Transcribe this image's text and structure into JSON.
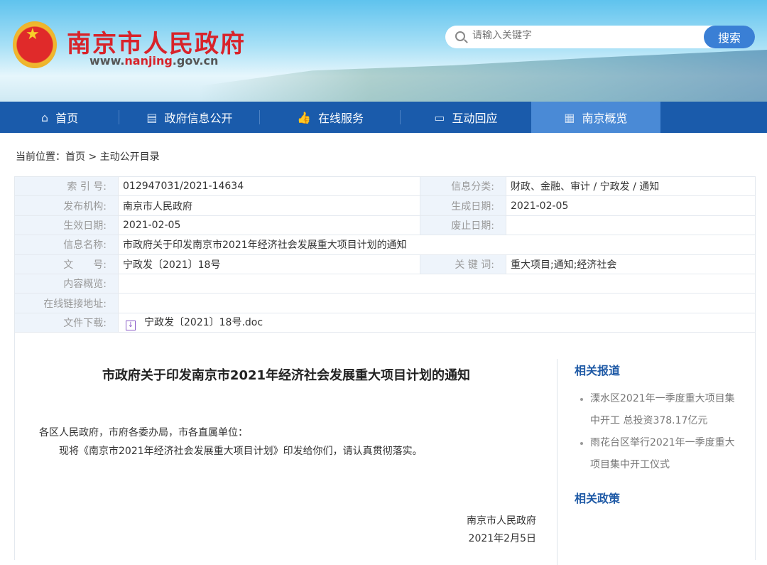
{
  "header": {
    "site_title": "南京市人民政府",
    "url_prefix": "www.",
    "url_mid": "nanjing",
    "url_suffix": ".gov.cn",
    "search_placeholder": "请输入关键字",
    "search_button": "搜索"
  },
  "nav": [
    {
      "label": "首页",
      "icon": "home-icon"
    },
    {
      "label": "政府信息公开",
      "icon": "document-icon"
    },
    {
      "label": "在线服务",
      "icon": "thumbs-up-icon"
    },
    {
      "label": "互动回应",
      "icon": "chat-icon"
    },
    {
      "label": "南京概览",
      "icon": "building-icon",
      "active": true
    }
  ],
  "breadcrumb": {
    "prefix": "当前位置：",
    "home": "首页",
    "sep": ">",
    "current": "主动公开目录"
  },
  "meta": {
    "index_label": "索 引 号:",
    "index": "012947031/2021-14634",
    "category_label": "信息分类:",
    "category": "财政、金融、审计 / 宁政发 / 通知",
    "publisher_label": "发布机构:",
    "publisher": "南京市人民政府",
    "created_label": "生成日期:",
    "created": "2021-02-05",
    "effective_label": "生效日期:",
    "effective": "2021-02-05",
    "expire_label": "废止日期:",
    "expire": "",
    "name_label": "信息名称:",
    "name": "市政府关于印发南京市2021年经济社会发展重大项目计划的通知",
    "docno_label": "文　　号:",
    "docno": "宁政发〔2021〕18号",
    "keywords_label": "关 键 词:",
    "keywords": "重大项目;通知;经济社会",
    "summary_label": "内容概览:",
    "summary": "",
    "link_label": "在线链接地址:",
    "link": "",
    "download_label": "文件下载:",
    "download": "宁政发〔2021〕18号.doc"
  },
  "article": {
    "title": "市政府关于印发南京市2021年经济社会发展重大项目计划的通知",
    "greeting": "各区人民政府，市府各委办局，市各直属单位：",
    "body": "现将《南京市2021年经济社会发展重大项目计划》印发给你们，请认真贯彻落实。",
    "signer": "南京市人民政府",
    "date": "2021年2月5日"
  },
  "sidebar": {
    "related_news_title": "相关报道",
    "related_news": [
      "溧水区2021年一季度重大项目集中开工 总投资378.17亿元",
      "雨花台区举行2021年一季度重大项目集中开工仪式"
    ],
    "related_policy_title": "相关政策"
  }
}
